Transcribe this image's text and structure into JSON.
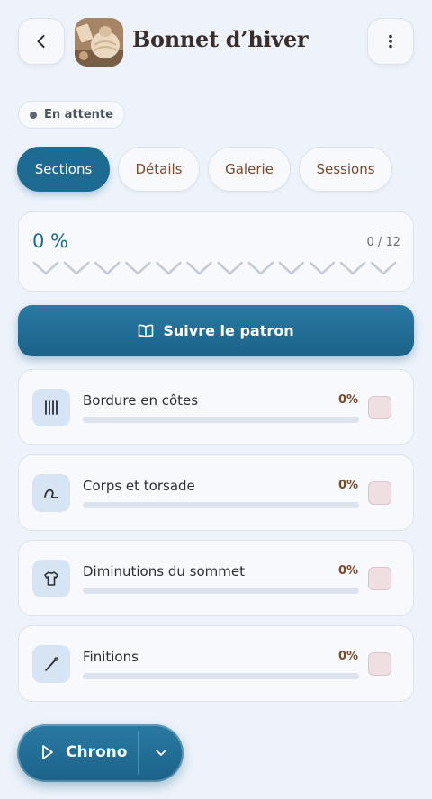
{
  "header": {
    "title": "Bonnet d’hiver",
    "back_icon": "chevron-left-icon",
    "menu_icon": "more-vertical-icon"
  },
  "status": {
    "label": "En attente"
  },
  "tabs": [
    {
      "label": "Sections",
      "active": true
    },
    {
      "label": "Détails",
      "active": false
    },
    {
      "label": "Galerie",
      "active": false
    },
    {
      "label": "Sessions",
      "active": false
    }
  ],
  "progress": {
    "percent_label": "0 %",
    "count_label": "0 / 12",
    "completed": 0,
    "total": 12
  },
  "follow_button": {
    "label": "Suivre le patron",
    "icon": "open-book-icon"
  },
  "sections": [
    {
      "name": "Bordure en côtes",
      "percent_label": "0%",
      "progress": 0,
      "icon": "ribbing-icon"
    },
    {
      "name": "Corps et torsade",
      "percent_label": "0%",
      "progress": 0,
      "icon": "cable-twist-icon"
    },
    {
      "name": "Diminutions du sommet",
      "percent_label": "0%",
      "progress": 0,
      "icon": "shirt-icon"
    },
    {
      "name": "Finitions",
      "percent_label": "0%",
      "progress": 0,
      "icon": "needle-icon"
    }
  ],
  "chrono": {
    "label": "Chrono",
    "play_icon": "play-icon",
    "dropdown_icon": "chevron-down-icon"
  },
  "colors": {
    "accent": "#1d6b92",
    "tab_text": "#7b4a2c",
    "background": "#eef3fb",
    "checkbox": "#f0dfe2"
  }
}
